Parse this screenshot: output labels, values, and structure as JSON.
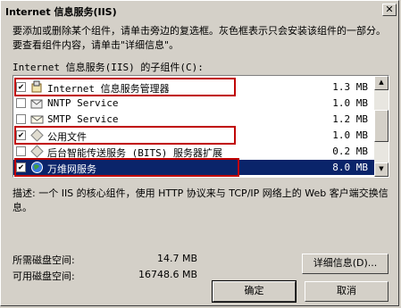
{
  "window": {
    "title": "Internet 信息服务(IIS)",
    "close_glyph": "✕"
  },
  "description": "要添加或删除某个组件，请单击旁边的复选框。灰色框表示只会安装该组件的一部分。要查看组件内容，请单击\"详细信息\"。",
  "list_label": "Internet 信息服务(IIS) 的子组件(C):",
  "components": [
    {
      "label": "Internet 信息服务管理器",
      "size": "1.3 MB",
      "checked": true,
      "icon": "iis-manager-icon"
    },
    {
      "label": "NNTP Service",
      "size": "1.0 MB",
      "checked": false,
      "icon": "nntp-icon"
    },
    {
      "label": "SMTP Service",
      "size": "1.2 MB",
      "checked": false,
      "icon": "smtp-icon"
    },
    {
      "label": "公用文件",
      "size": "1.0 MB",
      "checked": true,
      "icon": "common-files-icon"
    },
    {
      "label": "后台智能传送服务 (BITS) 服务器扩展",
      "size": "0.2 MB",
      "checked": false,
      "icon": "bits-icon"
    },
    {
      "label": "万维网服务",
      "size": "8.0 MB",
      "checked": true,
      "icon": "www-icon",
      "selected": true
    }
  ],
  "detail_description": "描述:  一个 IIS 的核心组件，使用 HTTP 协议来与 TCP/IP 网络上的 Web 客户端交换信息。",
  "disk_space": {
    "required_label": "所需磁盘空间:",
    "required_value": "14.7 MB",
    "available_label": "可用磁盘空间:",
    "available_value": "16748.6 MB"
  },
  "buttons": {
    "details": "详细信息(D)...",
    "ok": "确定",
    "cancel": "取消"
  },
  "colors": {
    "highlight_box": "#c00000",
    "selection": "#0a246a"
  }
}
